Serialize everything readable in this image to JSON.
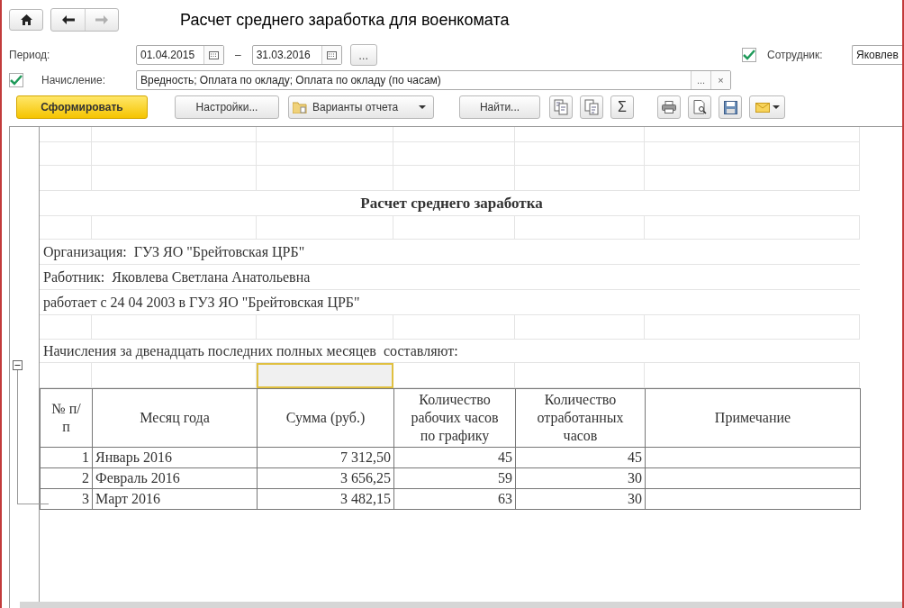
{
  "nav": [
    {
      "kind": "back",
      "disabled": false
    },
    {
      "kind": "forward",
      "disabled": true
    }
  ],
  "title": "Расчет среднего заработка для военкомата",
  "period": {
    "label": "Период:",
    "from": "01.04.2015",
    "separator": "–",
    "to": "31.03.2016",
    "more": "..."
  },
  "employee": {
    "checked": true,
    "label": "Сотрудник:",
    "value": "Яковлев"
  },
  "accrual": {
    "checked": true,
    "label": "Начисление:",
    "value": "Вредность; Оплата по окладу; Оплата по окладу (по часам)",
    "more": "...",
    "clear": "×"
  },
  "toolbar": [
    {
      "kind": "primary",
      "label": "Сформировать"
    },
    {
      "kind": "button",
      "label": "Настройки..."
    },
    {
      "kind": "menu",
      "label": "Варианты отчета"
    },
    {
      "kind": "button",
      "label": "Найти..."
    }
  ],
  "sum_button": "Σ",
  "report": {
    "title": "Расчет среднего заработка",
    "lines": [
      "Организация:  ГУЗ ЯО \"Брейтовская ЦРБ\"",
      "Работник:  Яковлева Светлана Анатольевна",
      "работает с 24 04 2003 в ГУЗ ЯО \"Брейтовская ЦРБ\""
    ],
    "intro": "Начисления за двенадцать последних полных месяцев  составляют:",
    "columns": [
      "№ п/п",
      "Месяц года",
      "Сумма (руб.)",
      "Количество рабочих часов по графику",
      "Количество отработанных часов",
      "Примечание"
    ],
    "rows": [
      [
        "1",
        "Январь 2016",
        "7 312,50",
        "45",
        "45",
        ""
      ],
      [
        "2",
        "Февраль 2016",
        "3 656,25",
        "59",
        "30",
        ""
      ],
      [
        "3",
        "Март 2016",
        "3 482,15",
        "63",
        "30",
        ""
      ]
    ]
  }
}
